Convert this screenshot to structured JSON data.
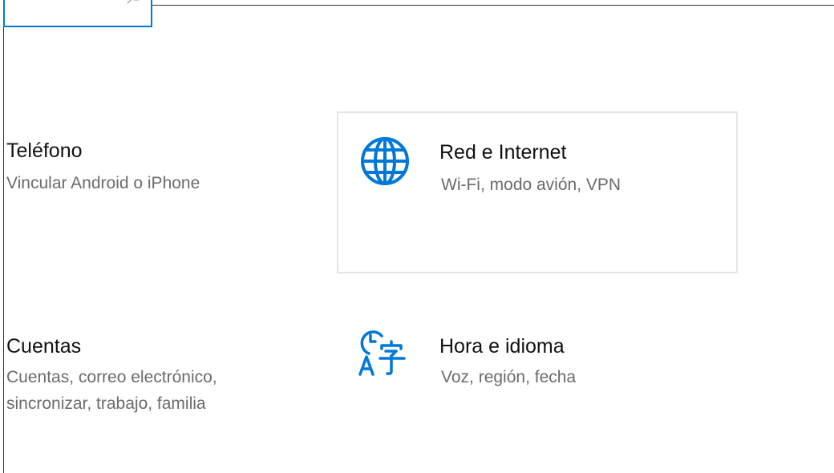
{
  "search": {
    "icon": "search-icon"
  },
  "tiles": [
    {
      "icon": "",
      "title": "Teléfono",
      "description": "Vincular Android o iPhone"
    },
    {
      "icon": "globe-icon",
      "title": "Red e Internet",
      "description": "Wi-Fi, modo avión, VPN"
    },
    {
      "icon": "",
      "title": "Cuentas",
      "description_line1": "Cuentas, correo electrónico,",
      "description_line2": "sincronizar, trabajo, familia"
    },
    {
      "icon": "time-language-icon",
      "title": "Hora e idioma",
      "description": "Voz, región, fecha"
    }
  ],
  "colors": {
    "accent": "#0078d7",
    "hover_border": "#e4e4e4",
    "description_text": "#6b6b6b"
  }
}
